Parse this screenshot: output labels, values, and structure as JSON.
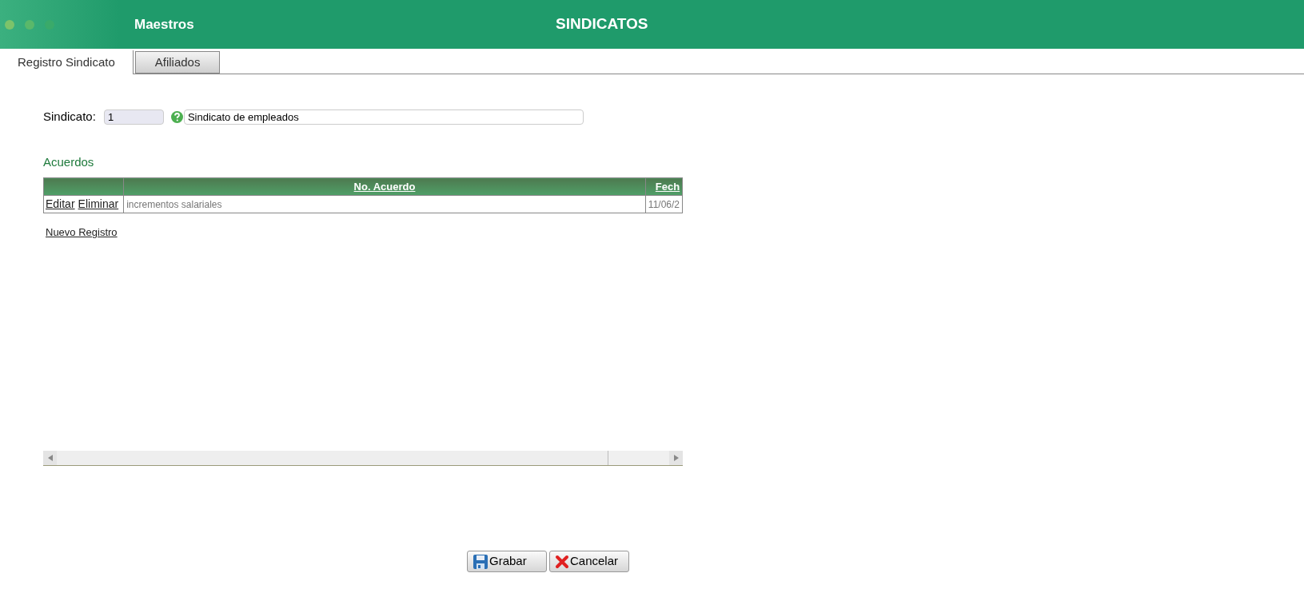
{
  "header": {
    "section": "Maestros",
    "title": "SINDICATOS"
  },
  "tabs": [
    {
      "label": "Registro Sindicato",
      "selected": true
    },
    {
      "label": "Afiliados",
      "selected": false
    }
  ],
  "form": {
    "label": "Sindicato:",
    "code": "1",
    "name": "Sindicato de empleados"
  },
  "acuerdos": {
    "title": "Acuerdos",
    "columns": [
      "No. Acuerdo",
      "Fech"
    ],
    "rows": [
      {
        "actions": [
          "Editar",
          "Eliminar"
        ],
        "cells": [
          "incrementos salariales",
          "11/06/2"
        ]
      }
    ],
    "new_link": "Nuevo Registro"
  },
  "buttons": [
    {
      "kind": "save",
      "label": "Grabar"
    },
    {
      "kind": "cancel",
      "label": "Cancelar"
    }
  ]
}
